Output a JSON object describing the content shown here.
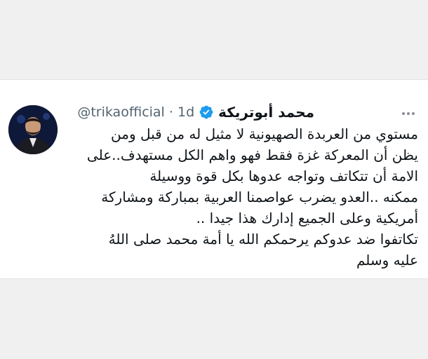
{
  "tweet": {
    "display_name": "محمد أبوتريكة",
    "handle": "@trikaofficial",
    "separator": "·",
    "time": "1d",
    "verified_color": "#1d9bf0",
    "more_icon": "more-horizontal-icon",
    "lines": [
      "مستوي من العربدة الصهيونية لا مثيل له من قبل ومن",
      "يظن أن المعركة غزة فقط فهو واهم الكل مستهدف..على",
      "الامة أن تتكاتف وتواجه عدوها بكل قوة ووسيلة",
      "ممكنه ..العدو يضرب عواصمنا العربية بمباركة ومشاركة",
      "أمريكية وعلى الجميع إدارك هذا جيدا ..",
      "تكاتفوا ضد عدوكم يرحمكم الله يا أمة محمد صلى اللهُ",
      "عليه وسلم"
    ]
  }
}
